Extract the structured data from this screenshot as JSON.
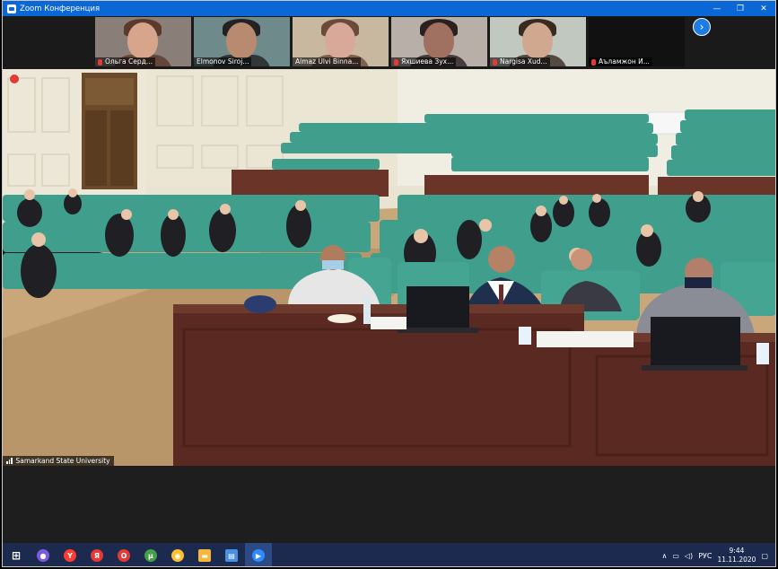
{
  "window": {
    "title": "Zoom Конференция"
  },
  "participants": [
    {
      "name": "Ольга Серд...",
      "bg": "#8a7f78",
      "face": "#d6a58c",
      "hair": "#5a3a2a",
      "muted": true
    },
    {
      "name": "Elmonov Siroj...",
      "bg": "#6f8a8a",
      "face": "#b88a70",
      "hair": "#222222",
      "muted": false
    },
    {
      "name": "Almaz Ülvi Binna...",
      "bg": "#c8b8a0",
      "face": "#d8a898",
      "hair": "#6a4a3a",
      "muted": false
    },
    {
      "name": "Яхшиева Зух...",
      "bg": "#b8b0a8",
      "face": "#a07060",
      "hair": "#2a2020",
      "muted": true
    },
    {
      "name": "Nargisa Xud...",
      "bg": "#c0c8c0",
      "face": "#d0a890",
      "hair": "#3a2a20",
      "muted": true
    },
    {
      "name": "Аъламжон И...",
      "bg": "#111111",
      "face": "",
      "hair": "",
      "muted": true
    }
  ],
  "main_video": {
    "camera_label": "Samarkand State University"
  },
  "taskbar": {
    "apps": [
      {
        "name": "windows-start",
        "color": "#1e90ff",
        "glyph": "⊞"
      },
      {
        "name": "search",
        "color": "#7b5ce0",
        "glyph": "●"
      },
      {
        "name": "yandex-browser",
        "color": "#ff3b30",
        "glyph": "Y"
      },
      {
        "name": "yandex",
        "color": "#e53935",
        "glyph": "Я"
      },
      {
        "name": "opera",
        "color": "#e53935",
        "glyph": "O"
      },
      {
        "name": "utorrent",
        "color": "#43a047",
        "glyph": "µ"
      },
      {
        "name": "chrome",
        "color": "#fbc02d",
        "glyph": "◉"
      },
      {
        "name": "file-explorer",
        "color": "#f6b73c",
        "glyph": "▬"
      },
      {
        "name": "notepad",
        "color": "#4a90e2",
        "glyph": "▤"
      },
      {
        "name": "zoom",
        "color": "#2d8cff",
        "glyph": "▶"
      }
    ],
    "language": "РУС",
    "time": "9:44",
    "date": "11.11.2020"
  }
}
